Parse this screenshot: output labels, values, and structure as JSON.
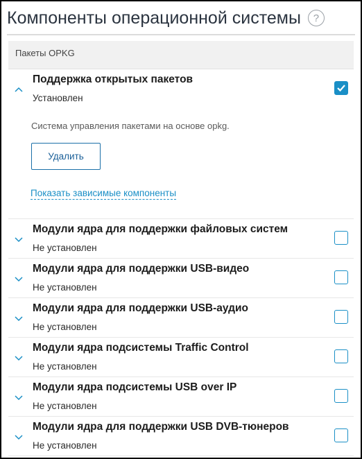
{
  "header": {
    "title": "Компоненты операционной системы",
    "help_glyph": "?"
  },
  "section": {
    "title": "Пакеты OPKG"
  },
  "expanded": {
    "title": "Поддержка открытых пакетов",
    "status": "Установлен",
    "checked": true,
    "description": "Система управления пакетами на основе opkg.",
    "remove_label": "Удалить",
    "deps_link": "Показать зависимые компоненты"
  },
  "items": [
    {
      "title": "Модули ядра для поддержки файловых систем",
      "status": "Не установлен",
      "checked": false
    },
    {
      "title": "Модули ядра для поддержки USB-видео",
      "status": "Не установлен",
      "checked": false
    },
    {
      "title": "Модули ядра для поддержки USB-аудио",
      "status": "Не установлен",
      "checked": false
    },
    {
      "title": "Модули ядра подсистемы Traffic Control",
      "status": "Не установлен",
      "checked": false
    },
    {
      "title": "Модули ядра подсистемы USB over IP",
      "status": "Не установлен",
      "checked": false
    },
    {
      "title": "Модули ядра для поддержки USB DVB-тюнеров",
      "status": "Не установлен",
      "checked": false
    }
  ],
  "colors": {
    "accent": "#1a8fc6",
    "button_border": "#1a6fa8"
  }
}
